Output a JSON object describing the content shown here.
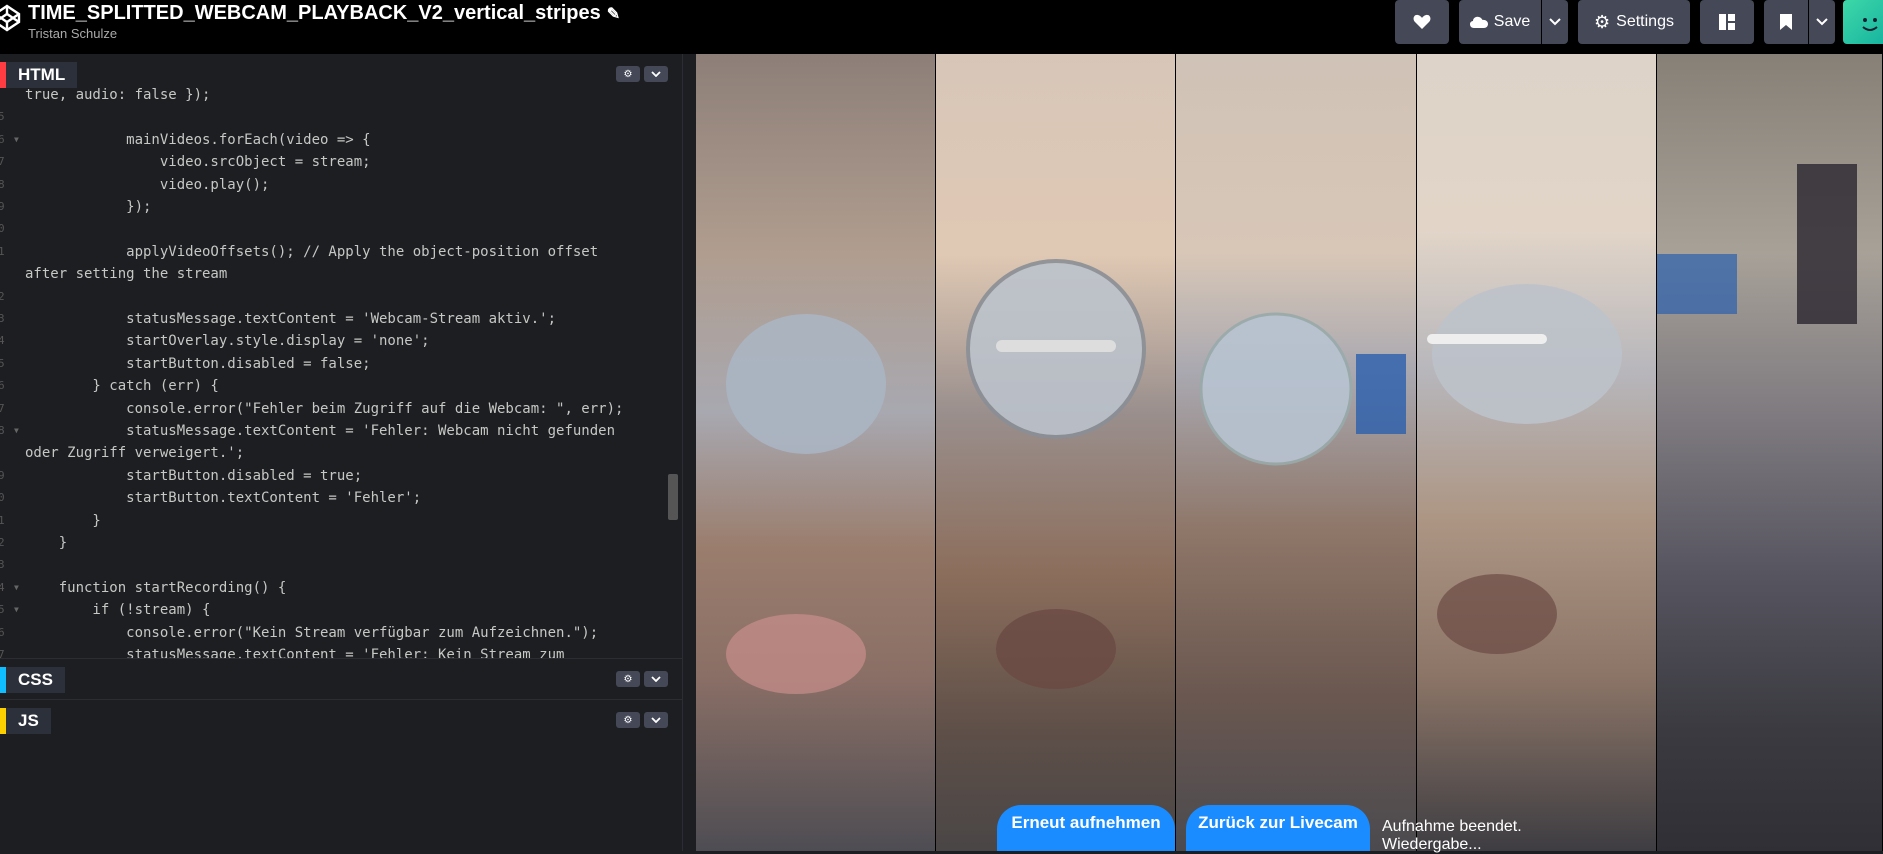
{
  "header": {
    "title": "TIME_SPLITTED_WEBCAM_PLAYBACK_V2_vertical_stripes",
    "author": "Tristan Schulze",
    "save_label": "Save",
    "settings_label": "Settings"
  },
  "icons": {
    "logo": "codepen-logo",
    "pencil": "pencil-icon",
    "heart": "heart-icon",
    "cloud": "cloud-icon",
    "gear": "gear-icon",
    "layout": "layout-icon",
    "bookmark": "bookmark-icon",
    "chevron": "chevron-down-icon",
    "avatar": "avatar"
  },
  "panels": {
    "html": "HTML",
    "css": "CSS",
    "js": "JS"
  },
  "code": [
    {
      "n": "",
      "text": "true, audio: false });"
    },
    {
      "n": "5",
      "text": ""
    },
    {
      "n": "6",
      "text": "            mainVideos.forEach(video => {"
    },
    {
      "n": "7",
      "text": "                video.srcObject = stream;"
    },
    {
      "n": "8",
      "text": "                video.play();"
    },
    {
      "n": "9",
      "text": "            });"
    },
    {
      "n": "0",
      "text": ""
    },
    {
      "n": "1",
      "text": "            applyVideoOffsets(); // Apply the object-position offset"
    },
    {
      "n": "",
      "text": "after setting the stream"
    },
    {
      "n": "2",
      "text": ""
    },
    {
      "n": "3",
      "text": "            statusMessage.textContent = 'Webcam-Stream aktiv.';"
    },
    {
      "n": "4",
      "text": "            startOverlay.style.display = 'none';"
    },
    {
      "n": "5",
      "text": "            startButton.disabled = false;"
    },
    {
      "n": "6",
      "text": "        } catch (err) {"
    },
    {
      "n": "7",
      "text": "            console.error(\"Fehler beim Zugriff auf die Webcam: \", err);"
    },
    {
      "n": "8",
      "text": "            statusMessage.textContent = 'Fehler: Webcam nicht gefunden"
    },
    {
      "n": "",
      "text": "oder Zugriff verweigert.';"
    },
    {
      "n": "9",
      "text": "            startButton.disabled = true;"
    },
    {
      "n": "0",
      "text": "            startButton.textContent = 'Fehler';"
    },
    {
      "n": "1",
      "text": "        }"
    },
    {
      "n": "2",
      "text": "    }"
    },
    {
      "n": "3",
      "text": ""
    },
    {
      "n": "4",
      "text": "    function startRecording() {"
    },
    {
      "n": "5",
      "text": "        if (!stream) {"
    },
    {
      "n": "6",
      "text": "            console.error(\"Kein Stream verfügbar zum Aufzeichnen.\");"
    },
    {
      "n": "7",
      "text": "            statusMessage.textContent = 'Fehler: Kein Stream zum"
    }
  ],
  "preview": {
    "record_again_label": "Erneut aufnehmen",
    "back_live_label": "Zurück zur Livecam",
    "status_text": "Aufnahme beendet. Wiedergabe..."
  },
  "colors": {
    "html_accent": "#ff3c41",
    "css_accent": "#0ebeff",
    "js_accent": "#fcd000",
    "button_blue": "#1a8cff"
  }
}
